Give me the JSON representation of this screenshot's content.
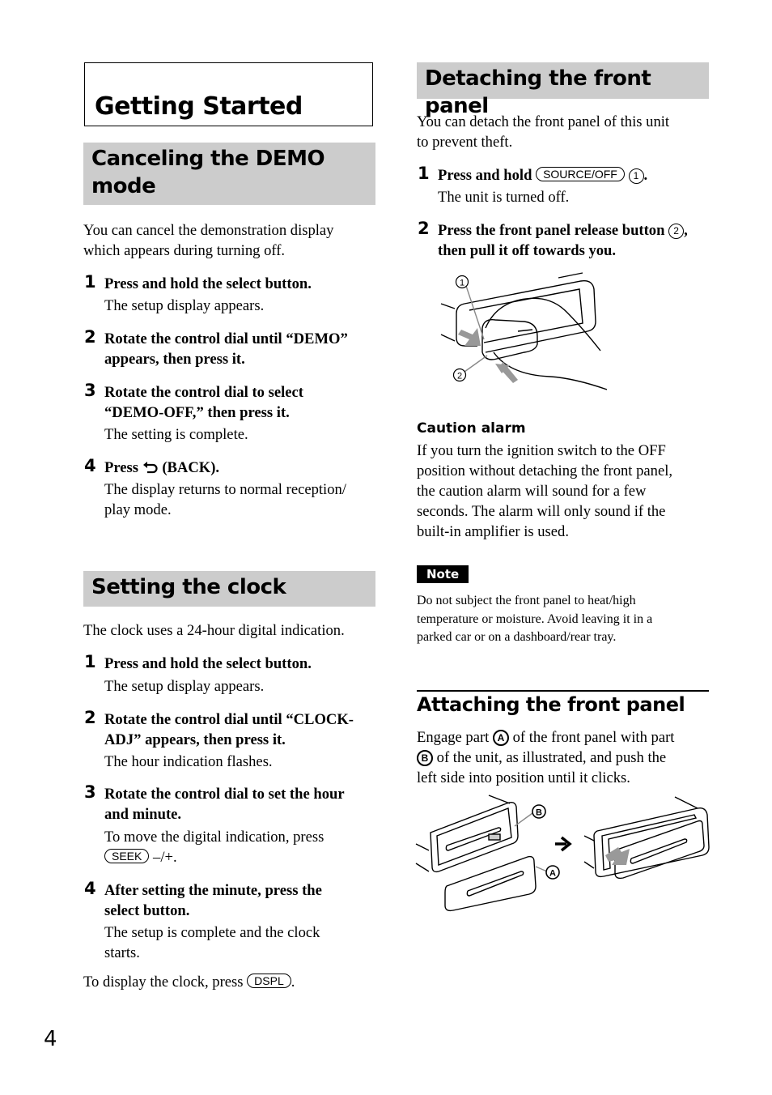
{
  "chapter": {
    "title": "Getting Started"
  },
  "demo": {
    "heading_line1": "Canceling the DEMO",
    "heading_line2": "mode",
    "intro_line1": "You can cancel the demonstration display",
    "intro_line2": "which appears during turning off.",
    "steps": [
      {
        "num": "1",
        "title": "Press and hold the select button.",
        "desc": "The setup display appears."
      },
      {
        "num": "2",
        "title_line1": "Rotate the control dial until “DEMO”",
        "title_line2": "appears, then press it."
      },
      {
        "num": "3",
        "title_line1": "Rotate the control dial to select",
        "title_line2": "“DEMO-OFF,” then press it.",
        "desc": "The setting is complete."
      },
      {
        "num": "4",
        "title_pre": "Press",
        "icon": "back-arrow-icon",
        "title_post": "(BACK).",
        "desc_line1": "The display returns to normal reception/",
        "desc_line2": "play mode."
      }
    ]
  },
  "clock": {
    "heading": "Setting the clock",
    "intro": "The clock uses a 24-hour digital indication.",
    "steps": [
      {
        "num": "1",
        "title": "Press and hold the select button.",
        "desc": "The setup display appears."
      },
      {
        "num": "2",
        "title_line1": "Rotate the control dial until “CLOCK-",
        "title_line2": "ADJ” appears, then press it.",
        "desc": "The hour indication flashes."
      },
      {
        "num": "3",
        "title_line1": "Rotate the control dial to set the hour",
        "title_line2": "and minute.",
        "desc_line1": "To move the digital indication, press",
        "desc_key": "SEEK",
        "desc_post": "–/+."
      },
      {
        "num": "4",
        "title_line1": "After setting the minute, press the",
        "title_line2": "select button.",
        "desc_line1": "The setup is complete and the clock",
        "desc_line2": "starts."
      }
    ],
    "footer_pre": "To display the clock, press",
    "footer_key": "DSPL",
    "footer_post": "."
  },
  "detach": {
    "heading": "Detaching the front panel",
    "intro_line1": "You can detach the front panel of this unit",
    "intro_line2": "to prevent theft.",
    "steps": [
      {
        "num": "1",
        "title_pre": "Press and hold",
        "key": "SOURCE/OFF",
        "ref": "1",
        "title_post": ".",
        "desc": "The unit is turned off."
      },
      {
        "num": "2",
        "title_line1_pre": "Press the front panel release button",
        "ref": "2",
        "title_line1_post": ",",
        "title_line2": "then pull it off towards you."
      }
    ],
    "figure_labels": [
      "1",
      "2"
    ],
    "caution": {
      "heading": "Caution alarm",
      "lines": [
        "If you turn the ignition switch to the OFF",
        "position without detaching the front panel,",
        "the caution alarm will sound for a few",
        "seconds. The alarm will only sound if the",
        "built-in amplifier is used."
      ]
    },
    "note": {
      "label": "Note",
      "lines": [
        "Do not subject the front panel to heat/high",
        "temperature or moisture. Avoid leaving it in a",
        "parked car or on a dashboard/rear tray."
      ]
    }
  },
  "attach": {
    "heading": "Attaching the front panel",
    "line1_pre": "Engage part",
    "line1_ref": "A",
    "line1_post": "of the front panel with part",
    "line2_ref": "B",
    "line2_post": "of the unit, as illustrated, and push the",
    "line3": "left side into position until it clicks.",
    "figure_labels": [
      "B",
      "A"
    ]
  },
  "page": {
    "number": "4"
  }
}
